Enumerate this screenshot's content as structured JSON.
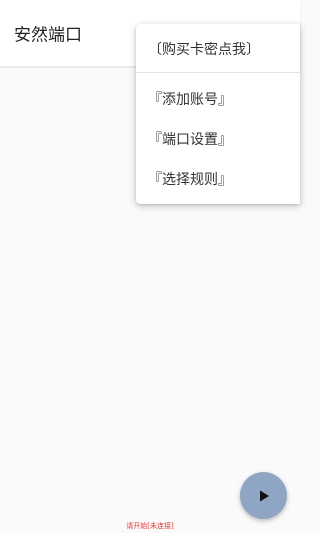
{
  "app_bar": {
    "title": "安然端口"
  },
  "menu": {
    "items": [
      {
        "label": "〔购买卡密点我〕"
      },
      {
        "label": "『添加账号』"
      },
      {
        "label": "『端口设置』"
      },
      {
        "label": "『选择规则』"
      }
    ]
  },
  "status": {
    "text": "请开始[未连接]",
    "color": "#e53935"
  },
  "fab": {
    "icon": "play-icon",
    "color": "#8ea6c3"
  }
}
